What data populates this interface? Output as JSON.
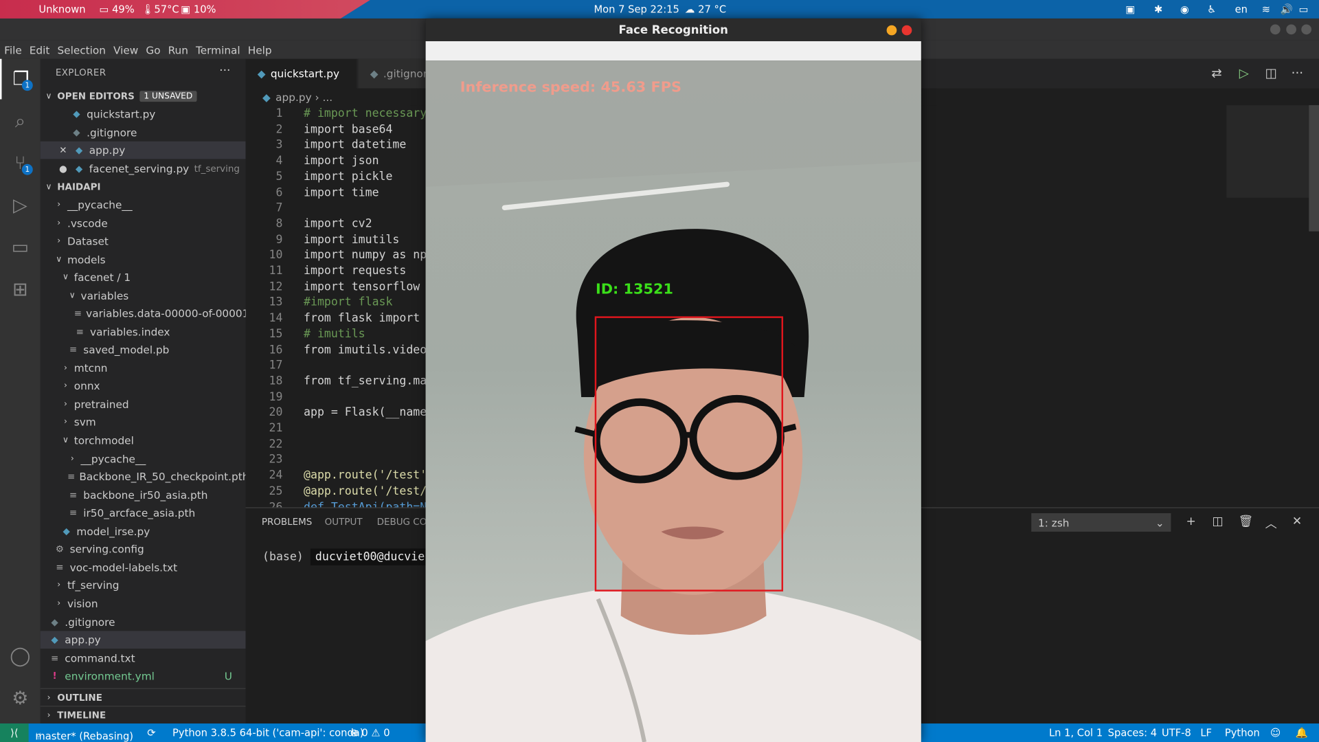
{
  "system_bar": {
    "app_name": "Unknown",
    "battery": "49%",
    "cpu_temp": "57°C",
    "disk": "10%",
    "datetime": "Mon 7 Sep  22:15",
    "weather": "27 °C",
    "lang": "en"
  },
  "menu": [
    "File",
    "Edit",
    "Selection",
    "View",
    "Go",
    "Run",
    "Terminal",
    "Help"
  ],
  "explorer": {
    "title": "EXPLORER",
    "more": "···",
    "open_editors_label": "OPEN EDITORS",
    "unsaved_badge": "1 UNSAVED",
    "open_editors": [
      {
        "name": "quickstart.py",
        "detail": ""
      },
      {
        "name": ".gitignore",
        "detail": ""
      },
      {
        "name": "app.py",
        "detail": ""
      },
      {
        "name": "facenet_serving.py",
        "detail": "tf_serving"
      }
    ],
    "project_label": "HAIDAPI",
    "tree": [
      {
        "name": "__pycache__"
      },
      {
        "name": ".vscode"
      },
      {
        "name": "Dataset"
      },
      {
        "name": "models"
      },
      {
        "name": "facenet / 1"
      },
      {
        "name": "variables"
      },
      {
        "name": "variables.data-00000-of-00001"
      },
      {
        "name": "variables.index"
      },
      {
        "name": "saved_model.pb"
      },
      {
        "name": "mtcnn"
      },
      {
        "name": "onnx"
      },
      {
        "name": "pretrained"
      },
      {
        "name": "svm"
      },
      {
        "name": "torchmodel"
      },
      {
        "name": "__pycache__"
      },
      {
        "name": "Backbone_IR_50_checkpoint.pth"
      },
      {
        "name": "backbone_ir50_asia.pth"
      },
      {
        "name": "ir50_arcface_asia.pth"
      },
      {
        "name": "model_irse.py"
      },
      {
        "name": "serving.config"
      },
      {
        "name": "voc-model-labels.txt"
      },
      {
        "name": "tf_serving"
      },
      {
        "name": "vision"
      },
      {
        "name": ".gitignore"
      },
      {
        "name": "app.py"
      },
      {
        "name": "command.txt"
      },
      {
        "name": "environment.yml",
        "status": "U"
      }
    ],
    "outline_label": "OUTLINE",
    "timeline_label": "TIMELINE"
  },
  "tabs": [
    "quickstart.py",
    ".gitignor"
  ],
  "breadcrumb": {
    "file": "app.py",
    "rest": "› ..."
  },
  "code_lines": [
    {
      "n": "1",
      "t": "# import necessary"
    },
    {
      "n": "2",
      "t": "import base64"
    },
    {
      "n": "3",
      "t": "import datetime"
    },
    {
      "n": "4",
      "t": "import json"
    },
    {
      "n": "5",
      "t": "import pickle"
    },
    {
      "n": "6",
      "t": "import time"
    },
    {
      "n": "7",
      "t": ""
    },
    {
      "n": "8",
      "t": "import cv2"
    },
    {
      "n": "9",
      "t": "import imutils"
    },
    {
      "n": "10",
      "t": "import numpy as np"
    },
    {
      "n": "11",
      "t": "import requests"
    },
    {
      "n": "12",
      "t": "import tensorflow"
    },
    {
      "n": "13",
      "t": "#import flask"
    },
    {
      "n": "14",
      "t": "from flask import"
    },
    {
      "n": "15",
      "t": "# imutils"
    },
    {
      "n": "16",
      "t": "from imutils.video"
    },
    {
      "n": "17",
      "t": ""
    },
    {
      "n": "18",
      "t": "from tf_serving.ma"
    },
    {
      "n": "19",
      "t": ""
    },
    {
      "n": "20",
      "t": "app = Flask(__name"
    },
    {
      "n": "21",
      "t": ""
    },
    {
      "n": "22",
      "t": ""
    },
    {
      "n": "23",
      "t": ""
    },
    {
      "n": "24",
      "t": "@app.route('/test'"
    },
    {
      "n": "25",
      "t": "@app.route('/test/"
    },
    {
      "n": "26",
      "t": "def TestApi(path=N"
    }
  ],
  "panel": {
    "tabs": [
      "PROBLEMS",
      "OUTPUT",
      "DEBUG CON"
    ],
    "terminal_env": "(base)",
    "terminal_user": "ducviet00@ducvie",
    "shell_select": "1: zsh"
  },
  "status_bar": {
    "branch": "master* (Rebasing)",
    "python": "Python 3.8.5 64-bit ('cam-api': conda)",
    "problems": "⊗ 0 ⚠ 0",
    "position": "Ln 1, Col 1",
    "spaces": "Spaces: 4",
    "encoding": "UTF-8",
    "eol": "LF",
    "language": "Python"
  },
  "face_window": {
    "title": "Face Recognition",
    "fps_text": "Inference speed: 45.63 FPS",
    "id_text": "ID: 13521"
  }
}
